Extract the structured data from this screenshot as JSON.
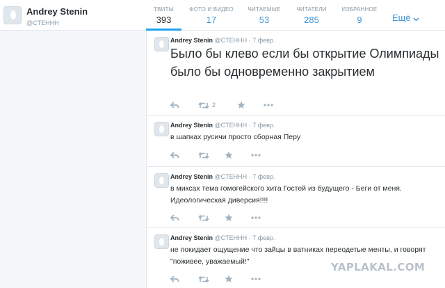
{
  "profile": {
    "name": "Andrey Stenin",
    "handle": "@CTEHHH"
  },
  "nav": {
    "stats": [
      {
        "label": "ТВИТЫ",
        "value": "393"
      },
      {
        "label": "ФОТО И ВИДЕО",
        "value": "17"
      },
      {
        "label": "ЧИТАЕМЫЕ",
        "value": "53"
      },
      {
        "label": "ЧИТАТЕЛИ",
        "value": "285"
      },
      {
        "label": "ИЗБРАННОЕ",
        "value": "9"
      }
    ],
    "more_label": "Ещё"
  },
  "tweets": [
    {
      "name": "Andrey Stenin",
      "handle": "@CTEHHH",
      "separator": "·",
      "time": "7 февр.",
      "text": "Было бы клево если бы открытие Олимпиады было бы одновременно закрытием",
      "retweets": "2"
    },
    {
      "name": "Andrey Stenin",
      "handle": "@CTEHHH",
      "separator": "·",
      "time": "7 февр.",
      "text": "в шапках русичи просто сборная Перу",
      "retweets": ""
    },
    {
      "name": "Andrey Stenin",
      "handle": "@CTEHHH",
      "separator": "·",
      "time": "7 февр.",
      "text": "в миксах тема гомогейского хита Гостей из будущего - Беги от меня. Идеологическая диверсия!!!!",
      "retweets": ""
    },
    {
      "name": "Andrey Stenin",
      "handle": "@CTEHHH",
      "separator": "·",
      "time": "7 февр.",
      "text": "не покидает ощущение что зайцы в ватниках переодетые менты, и говорят \"поживее, уважаемый!\"",
      "retweets": ""
    }
  ],
  "watermark": "YAPLAKAL.COM",
  "colors": {
    "accent": "#1da1f2",
    "link": "#3b94d9",
    "muted": "#8899a6",
    "icon": "#a2b2bf"
  },
  "icons": {
    "reply": "reply-icon",
    "retweet": "retweet-icon",
    "favorite": "star-icon",
    "more": "ellipsis-icon",
    "dropdown": "chevron-down-icon",
    "avatar": "default-egg-avatar-icon"
  }
}
